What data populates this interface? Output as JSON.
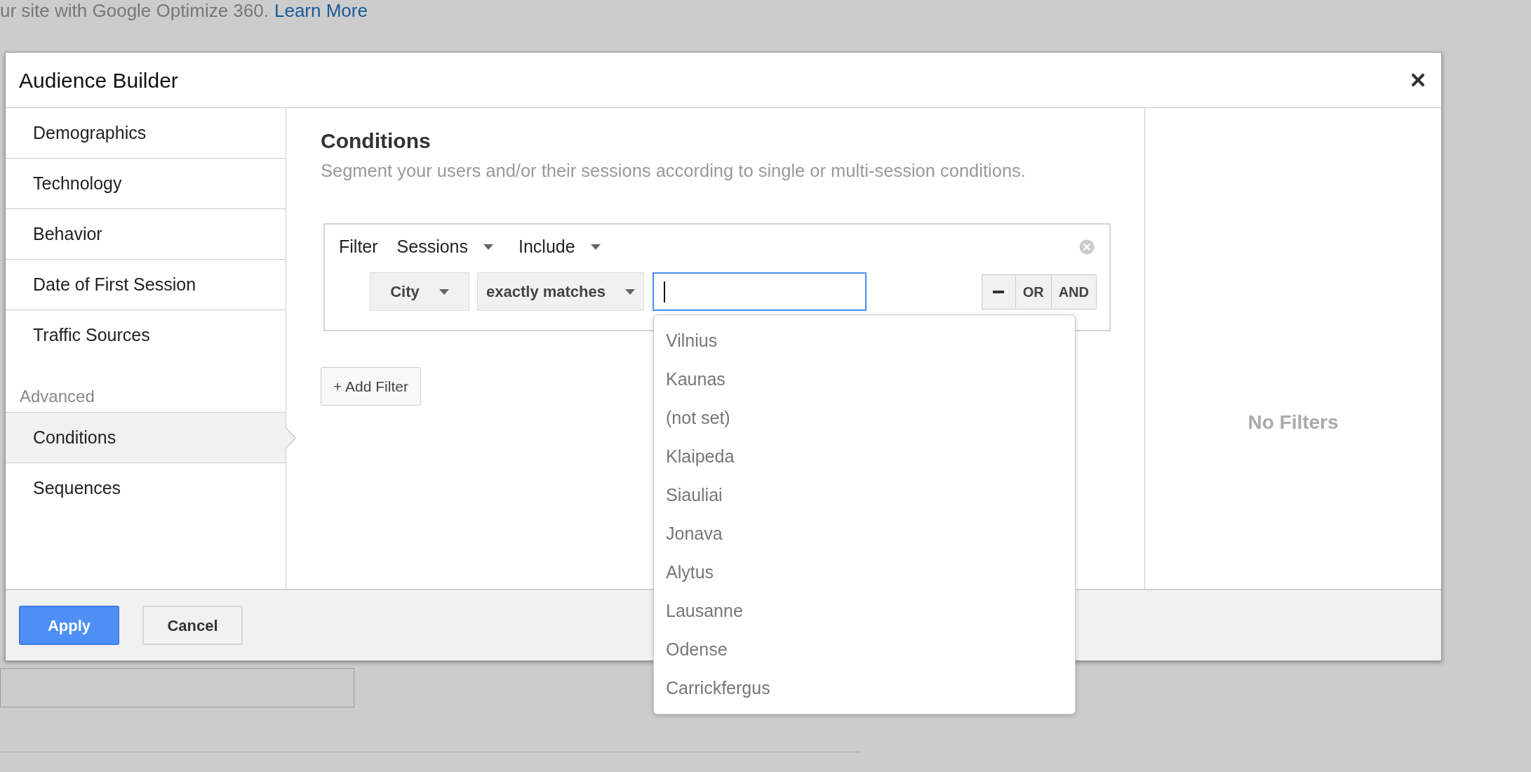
{
  "background": {
    "notice": "ur site with Google Optimize 360.",
    "link": "Learn More"
  },
  "dialog": {
    "title": "Audience Builder"
  },
  "sidebar": {
    "items": [
      {
        "label": "Demographics",
        "selected": false
      },
      {
        "label": "Technology",
        "selected": false
      },
      {
        "label": "Behavior",
        "selected": false
      },
      {
        "label": "Date of First Session",
        "selected": false
      },
      {
        "label": "Traffic Sources",
        "selected": false
      }
    ],
    "section": "Advanced",
    "advanced_items": [
      {
        "label": "Conditions",
        "selected": true
      },
      {
        "label": "Sequences",
        "selected": false
      }
    ]
  },
  "main": {
    "heading": "Conditions",
    "subtitle": "Segment your users and/or their sessions according to single or multi-session conditions.",
    "filter": {
      "label": "Filter",
      "scope": "Sessions",
      "mode": "Include",
      "dimension": "City",
      "operator": "exactly matches",
      "logic_buttons": [
        "OR",
        "AND"
      ]
    },
    "suggestions": [
      "Vilnius",
      "Kaunas",
      "(not set)",
      "Klaipeda",
      "Siauliai",
      "Jonava",
      "Alytus",
      "Lausanne",
      "Odense",
      "Carrickfergus"
    ],
    "add_filter": "+ Add Filter"
  },
  "summary": {
    "empty_text": "No Filters"
  },
  "footer": {
    "buttons": [
      {
        "label": "Apply",
        "kind": "primary"
      },
      {
        "label": "Cancel",
        "kind": "secondary"
      }
    ]
  }
}
